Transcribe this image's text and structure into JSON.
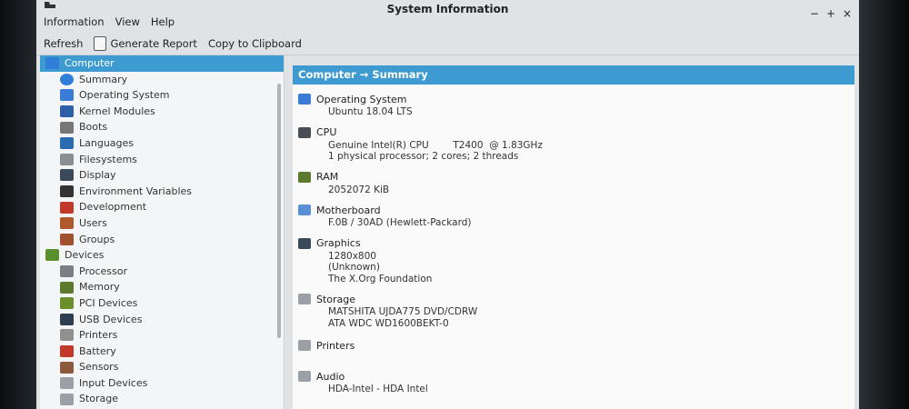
{
  "window": {
    "title": "System Information",
    "controls": {
      "minimize": "−",
      "maximize": "+",
      "close": "×"
    }
  },
  "menu": [
    "Information",
    "View",
    "Help"
  ],
  "toolbar": {
    "refresh": "Refresh",
    "generate_report": "Generate Report",
    "copy_clipboard": "Copy to Clipboard"
  },
  "sidebar": {
    "computer": {
      "label": "Computer",
      "items": [
        {
          "label": "Summary",
          "icon": "info-icon",
          "color": "#2f7ed8"
        },
        {
          "label": "Operating System",
          "icon": "os-gear-icon",
          "color": "#3a7bd5"
        },
        {
          "label": "Kernel Modules",
          "icon": "kernel-icon",
          "color": "#2d5ea8"
        },
        {
          "label": "Boots",
          "icon": "boots-icon",
          "color": "#777777"
        },
        {
          "label": "Languages",
          "icon": "flag-icon",
          "color": "#2b6cb0"
        },
        {
          "label": "Filesystems",
          "icon": "filesystem-icon",
          "color": "#8a8f94"
        },
        {
          "label": "Display",
          "icon": "monitor-icon",
          "color": "#3a4a5a"
        },
        {
          "label": "Environment Variables",
          "icon": "terminal-icon",
          "color": "#333333"
        },
        {
          "label": "Development",
          "icon": "development-icon",
          "color": "#c0392b"
        },
        {
          "label": "Users",
          "icon": "users-icon",
          "color": "#b05a2a"
        },
        {
          "label": "Groups",
          "icon": "groups-icon",
          "color": "#a0522d"
        }
      ]
    },
    "devices": {
      "label": "Devices",
      "items": [
        {
          "label": "Processor",
          "icon": "processor-icon",
          "color": "#7a7f86"
        },
        {
          "label": "Memory",
          "icon": "memory-icon",
          "color": "#5b7a2e"
        },
        {
          "label": "PCI Devices",
          "icon": "pci-icon",
          "color": "#6a8f2a"
        },
        {
          "label": "USB Devices",
          "icon": "usb-icon",
          "color": "#2c3e50"
        },
        {
          "label": "Printers",
          "icon": "printer-icon",
          "color": "#909090"
        },
        {
          "label": "Battery",
          "icon": "battery-icon",
          "color": "#c0392b"
        },
        {
          "label": "Sensors",
          "icon": "sensor-icon",
          "color": "#8b5a3c"
        },
        {
          "label": "Input Devices",
          "icon": "keyboard-icon",
          "color": "#9aa0a6"
        },
        {
          "label": "Storage",
          "icon": "storage-icon",
          "color": "#9aa0a6"
        }
      ]
    },
    "devices_icon_color": "#5a8f2e"
  },
  "content": {
    "header": "Computer → Summary",
    "sections": [
      {
        "title": "Operating System",
        "icon": "os-gear-icon",
        "color": "#3a7bd5",
        "lines": [
          "Ubuntu 18.04 LTS"
        ]
      },
      {
        "title": "CPU",
        "icon": "cpu-icon",
        "color": "#4a4f55",
        "lines": [
          "Genuine Intel(R) CPU        T2400  @ 1.83GHz",
          "1 physical processor; 2 cores; 2 threads"
        ]
      },
      {
        "title": "RAM",
        "icon": "ram-icon",
        "color": "#5b7a2e",
        "lines": [
          "2052072 KiB"
        ]
      },
      {
        "title": "Motherboard",
        "icon": "motherboard-icon",
        "color": "#5a8fd5",
        "lines": [
          "F.0B / 30AD (Hewlett-Packard)"
        ]
      },
      {
        "title": "Graphics",
        "icon": "graphics-icon",
        "color": "#3a4a5a",
        "lines": [
          "1280x800",
          "(Unknown)",
          "The X.Org Foundation"
        ]
      },
      {
        "title": "Storage",
        "icon": "storage-icon",
        "color": "#9aa0a6",
        "lines": [
          "MATSHITA UJDA775 DVD/CDRW",
          "ATA WDC WD1600BEKT-0"
        ]
      },
      {
        "title": "Printers",
        "icon": "printer-icon",
        "color": "#9aa0a6",
        "lines": []
      },
      {
        "title": "Audio",
        "icon": "audio-icon",
        "color": "#9aa0a6",
        "lines": [
          "HDA-Intel - HDA Intel"
        ]
      }
    ]
  },
  "colors": {
    "selection": "#3d9bd1",
    "accent": "#3d9bd1"
  }
}
